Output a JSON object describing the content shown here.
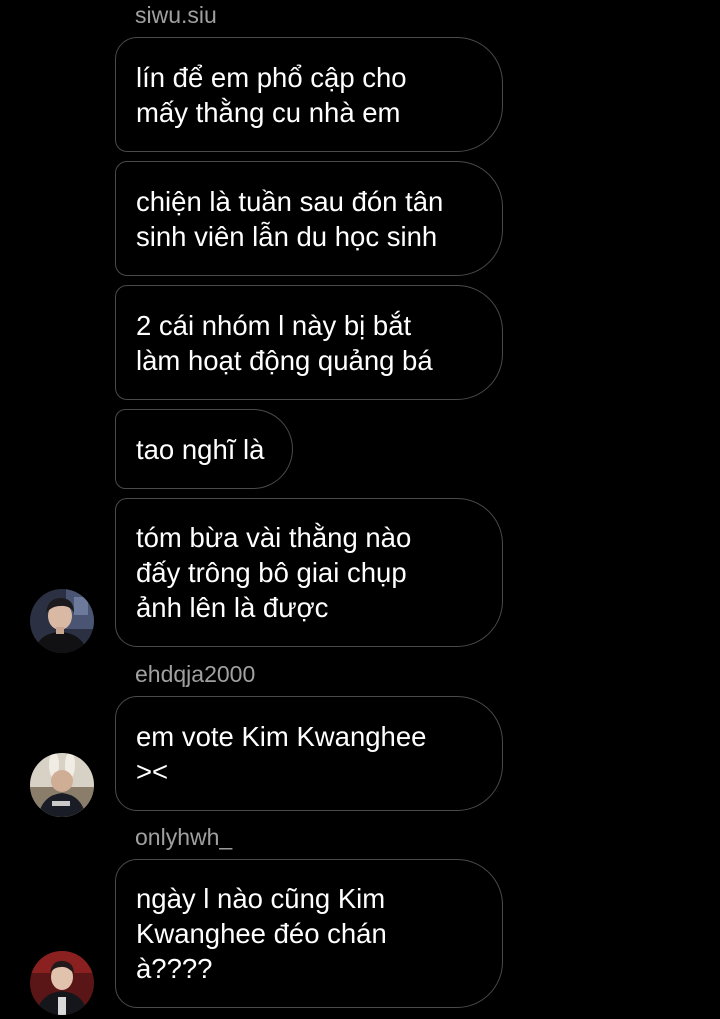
{
  "thread": {
    "groups": [
      {
        "sender": "siwu.siu",
        "messages": [
          "lín để em phổ cập cho\nmấy thằng cu nhà em",
          "chiện là tuần sau đón tân\nsinh viên lẫn du học sinh",
          "2 cái nhóm l này bị bắt\nlàm hoạt động quảng bá",
          "tao nghĩ là",
          "tóm bừa vài thằng nào\nđấy trông bô giai chụp\nảnh lên là được"
        ],
        "avatar_icon": "user-avatar-photo"
      },
      {
        "sender": "ehdqja2000",
        "messages": [
          "em vote Kim Kwanghee\n><"
        ],
        "avatar_icon": "user-avatar-photo"
      },
      {
        "sender": "onlyhwh_",
        "messages": [
          "ngày l nào cũng Kim\nKwanghee đéo chán\nà????"
        ],
        "avatar_icon": "user-avatar-photo"
      }
    ]
  },
  "colors": {
    "background": "#000000",
    "bubble_border": "#4a4a4a",
    "message_text": "#ffffff",
    "sender_text": "#a0a0a0"
  }
}
